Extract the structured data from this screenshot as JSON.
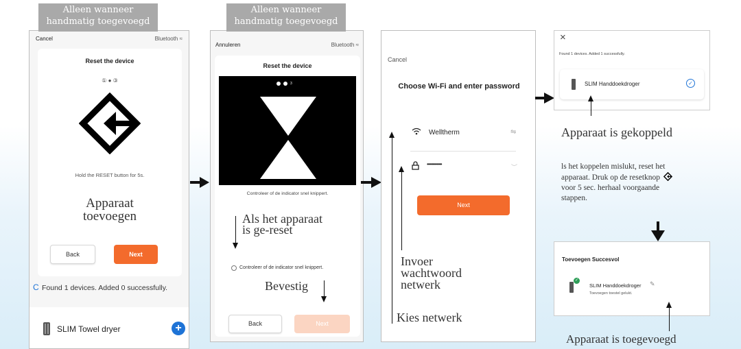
{
  "tags": {
    "tag1": [
      "Alleen wanneer",
      "handmatig toegevoegd"
    ],
    "tag2": [
      "Alleen wanneer",
      "handmatig toegevoegd"
    ]
  },
  "screen1": {
    "cancel": "Cancel",
    "bluetooth": "Bluetooth ≈",
    "title": "Reset the device",
    "steps": "① ● ③",
    "hint": "Hold the RESET button for 5s.",
    "annotation": [
      "Apparaat",
      "toevoegen"
    ],
    "back": "Back",
    "next": "Next",
    "found": "Found 1 devices. Added 0 successfully.",
    "device": "SLIM Towel dryer",
    "add_symbol": "+"
  },
  "screen2": {
    "cancel": "Annuleren",
    "bluetooth": "Bluetooth ≈",
    "title": "Reset the device",
    "step_num": "3",
    "caption": "Controleer of de indicator snel knippert.",
    "annotation": [
      "Als het apparaat",
      "is ge-reset"
    ],
    "radio_label": "Controleer of de indicator snel knippert.",
    "confirm": "Bevestig",
    "back": "Back",
    "next": "Next"
  },
  "screen3": {
    "cancel": "Cancel",
    "title": "Choose Wi-Fi and enter password",
    "ssid": "Welltherm",
    "password": "••••••••••••",
    "next": "Next",
    "annotation_pw": [
      "Invoer",
      "wachtwoord",
      "netwerk"
    ],
    "annotation_net": "Kies netwerk"
  },
  "screen4": {
    "close": "×",
    "found": "Found 1 devices. Added 1 successfully.",
    "device": "SLIM Handdoekdroger",
    "annotation": "Apparaat is gekoppeld"
  },
  "note": [
    "ls het koppelen mislukt, reset het",
    "apparaat. Druk op de resetknop",
    "voor 5 sec. herhaal voorgaande",
    "stappen."
  ],
  "screen5": {
    "title": "Toevoegen Succesvol",
    "device": "SLIM Handdoekdroger",
    "sub": "Toevoegen toestel gelukt.",
    "annotation": "Apparaat is toegevoegd"
  },
  "colors": {
    "accent": "#f36b2c",
    "blue": "#1e73d6",
    "check": "#2e9e58"
  }
}
